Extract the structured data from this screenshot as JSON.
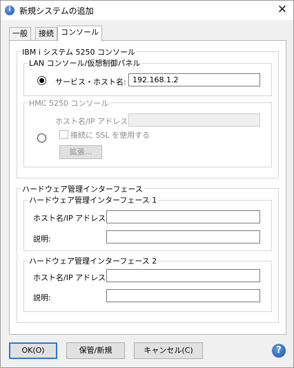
{
  "window": {
    "title": "新規システムの追加",
    "close_glyph": "✕",
    "app_icon_letter": "i"
  },
  "tabs": [
    {
      "label": "一般"
    },
    {
      "label": "接続"
    },
    {
      "label": "コンソール"
    }
  ],
  "console_group": {
    "title": "IBM i システム 5250 コンソール",
    "lan": {
      "title": "LAN コンソール/仮想制御パネル",
      "service_host_label": "サービス・ホスト名:",
      "service_host_value": "192.168.1.2",
      "selected": true
    },
    "hmc": {
      "title": "HMC 5250 コンソール",
      "host_label": "ホスト名/IP アドレス:",
      "host_value": "",
      "ssl_label": "接続に SSL を使用する",
      "ssl_checked": false,
      "extend_label": "拡張...",
      "selected": false
    }
  },
  "hw_group": {
    "title": "ハードウェア管理インターフェース",
    "if1": {
      "title": "ハードウェア管理インターフェース 1",
      "host_label": "ホスト名/IP アドレス:",
      "host_value": "",
      "desc_label": "説明:",
      "desc_value": ""
    },
    "if2": {
      "title": "ハードウェア管理インターフェース 2",
      "host_label": "ホスト名/IP アドレス:",
      "host_value": "",
      "desc_label": "説明:",
      "desc_value": ""
    }
  },
  "buttons": {
    "ok": "OK(O)",
    "save_new": "保管/新規",
    "cancel": "キャンセル(C)",
    "help_glyph": "?"
  }
}
